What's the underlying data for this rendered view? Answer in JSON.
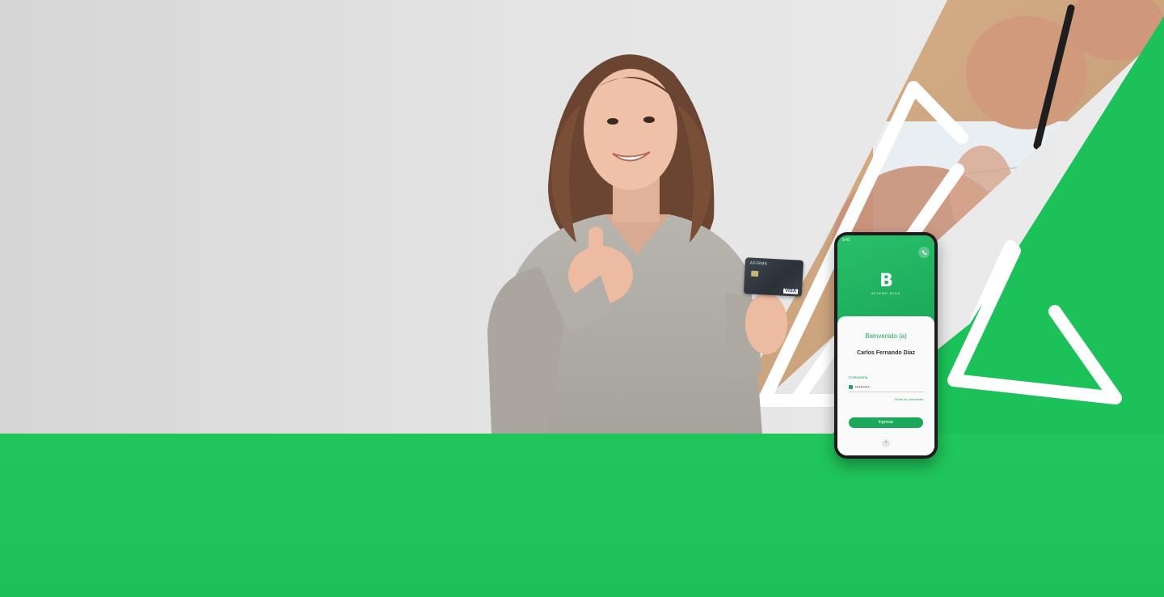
{
  "colors": {
    "brand_green": "#1dc159",
    "brand_green_dark": "#1ba85a",
    "background_gray": "#e4e4e4"
  },
  "card": {
    "brand": "AFIRME",
    "network": "VISA"
  },
  "phone": {
    "status_time": "9:41",
    "logo_mark": "B",
    "logo_sub": "AFIRME BISS",
    "welcome": "Bienvenido (a)",
    "user_name": "Carlos Fernando Díaz",
    "password_label": "Contraseña",
    "password_value": "••••••••",
    "forgot_password": "Olvidé mi contraseña",
    "submit_button": "Ingresar",
    "icons": {
      "call": "phone-icon",
      "lock": "lock-icon",
      "chevron": "chevron-up-icon"
    }
  }
}
